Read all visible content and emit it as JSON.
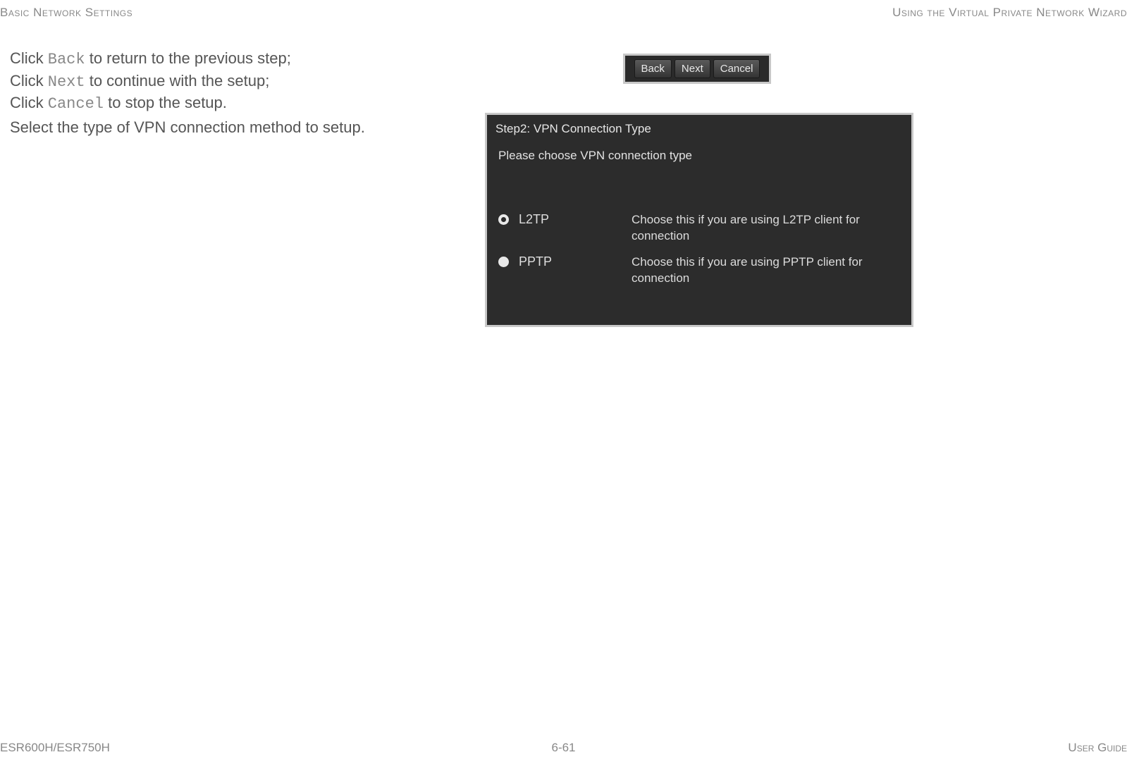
{
  "header": {
    "left": "Basic Network Settings",
    "right": "Using the Virtual Private Network Wizard"
  },
  "instructions": {
    "line1_pre": "Click ",
    "line1_cmd": "Back",
    "line1_post": " to return to the previous step;",
    "line2_pre": "Click ",
    "line2_cmd": "Next",
    "line2_post": " to continue with the setup;",
    "line3_pre": "Click ",
    "line3_cmd": "Cancel",
    "line3_post": " to stop the setup."
  },
  "select_line": "Select the type of VPN connection method to setup.",
  "buttons": {
    "back": "Back",
    "next": "Next",
    "cancel": "Cancel"
  },
  "wizard": {
    "step_title": "Step2: VPN Connection Type",
    "subtitle": "Please choose VPN connection type",
    "options": [
      {
        "label": "L2TP",
        "description": "Choose this if you are using L2TP client for connection",
        "selected": true
      },
      {
        "label": "PPTP",
        "description": "Choose this if you are using PPTP client for connection",
        "selected": false
      }
    ]
  },
  "footer": {
    "left": "ESR600H/ESR750H",
    "center": "6-61",
    "right": "User Guide"
  }
}
